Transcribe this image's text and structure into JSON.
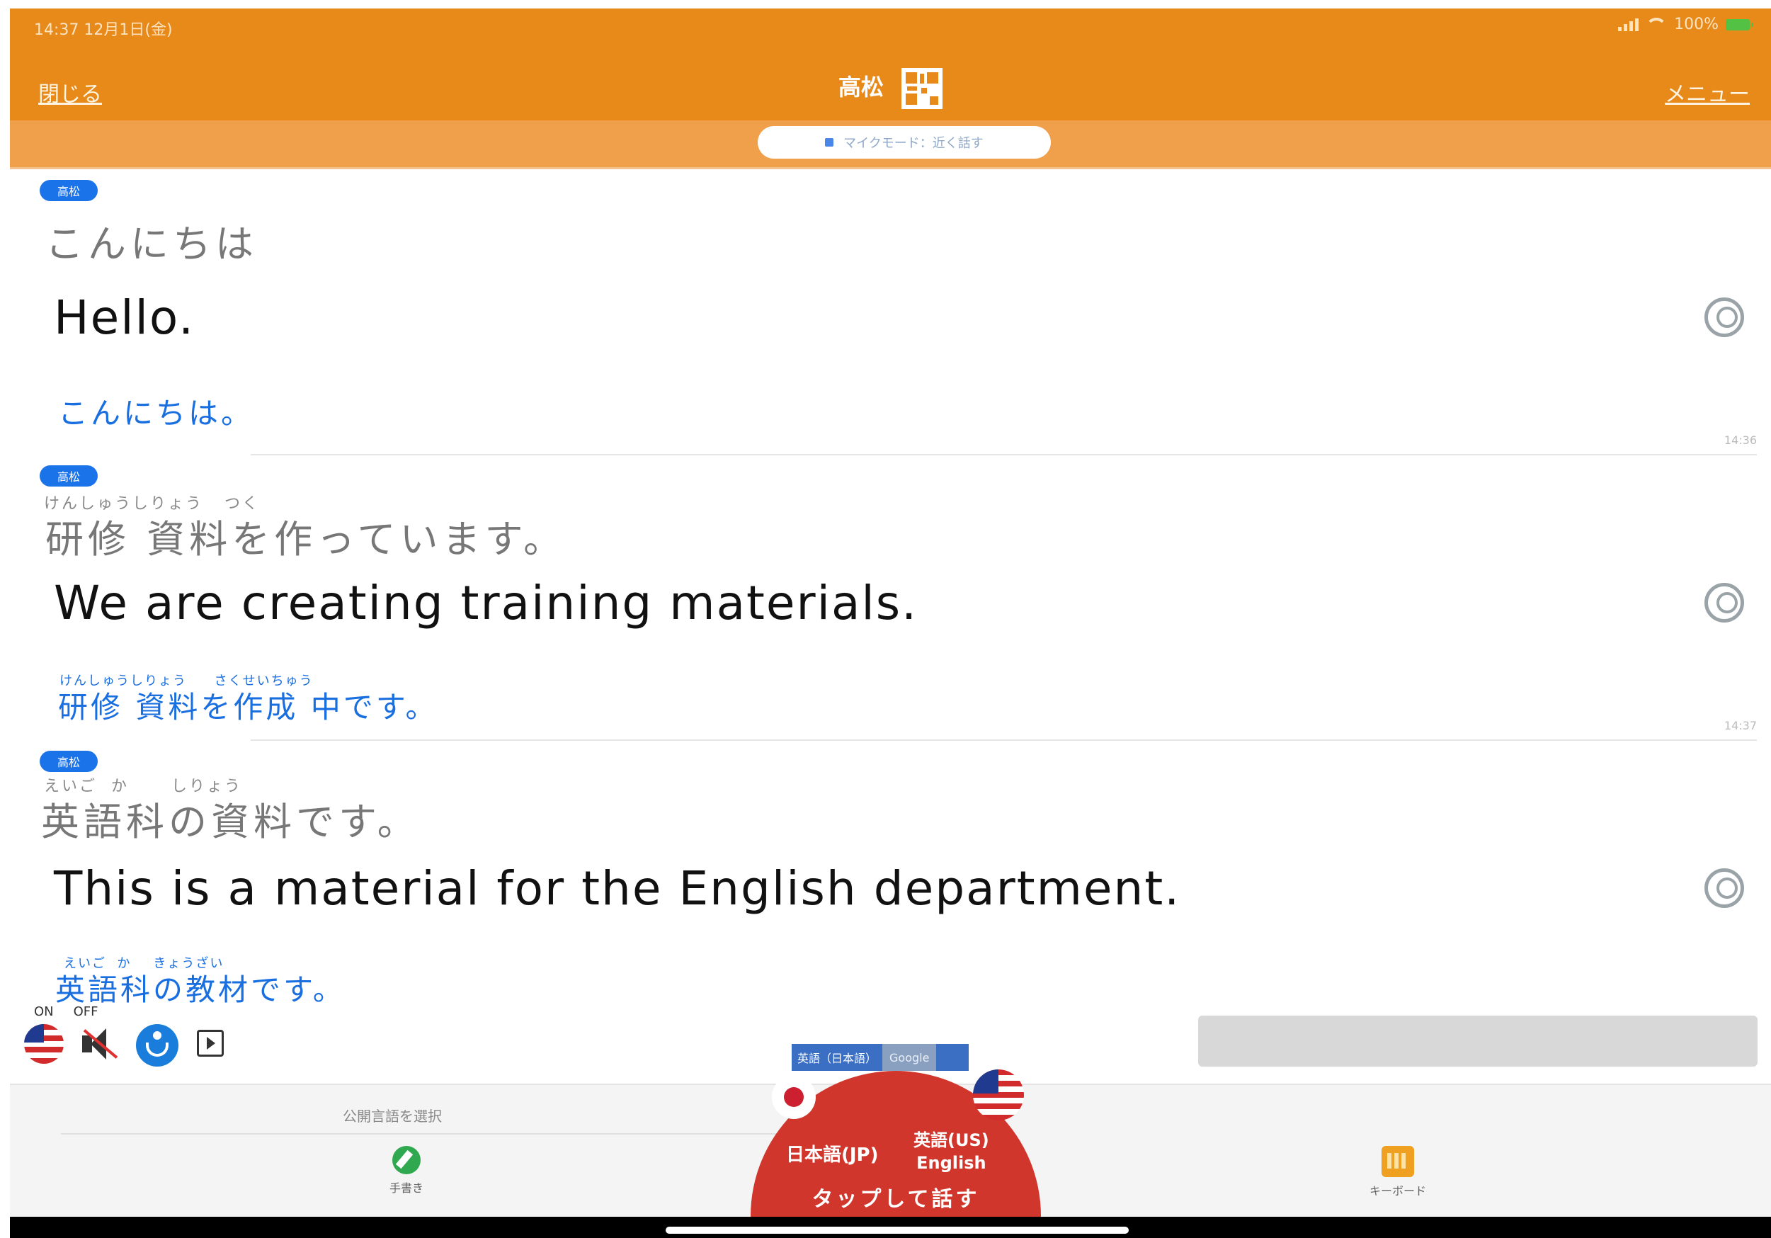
{
  "status_bar": {
    "time": "14:37 12月1日(金)",
    "battery": "100%"
  },
  "header": {
    "close_label": "閉じる",
    "title": "高松",
    "menu_label": "メニュー",
    "qr_icon": "qr-code-icon",
    "background_color": "#e88a1a"
  },
  "mode_pill": {
    "label": "マイクモード：近く話す"
  },
  "messages": [
    {
      "speaker": "高松",
      "source_ruby": "",
      "source_text": "こんにちは",
      "translated_text": "Hello.",
      "back_ruby": "",
      "back_translation": "こんにちは。",
      "timestamp": "14:36"
    },
    {
      "speaker": "高松",
      "source_ruby": "けんしゅうしりょう   つく",
      "source_text": "研修 資料を作っています。",
      "translated_text": "We are creating training materials.",
      "back_ruby": "けんしゅうしりょう     さくせいちゅう",
      "back_translation": "研修 資料を作成 中です。",
      "timestamp": "14:37"
    },
    {
      "speaker": "高松",
      "source_ruby": "えいご  か      しりょう",
      "source_text": "英語科の資料です。",
      "translated_text": "This is a material for the English department.",
      "back_ruby": "えいご  か    きょうざい",
      "back_translation": "英語科の教材です。",
      "timestamp": ""
    }
  ],
  "toggles": {
    "on_label": "ON",
    "off_label": "OFF",
    "icons": [
      "us-flag-icon",
      "speaker-muted-icon",
      "accessibility-icon",
      "play-icon"
    ]
  },
  "bottom_bar": {
    "select_language_label": "公開言語を選択",
    "handwrite_label": "手書き",
    "keyboard_label": "キーボード",
    "engine_label": "英語（日本語）",
    "engine_provider": "Google",
    "lang_from": "日本語(JP)",
    "lang_to_line1": "英語(US)",
    "lang_to_line2": "English",
    "tap_label": "タップして話す",
    "mic_color": "#d0362c"
  }
}
